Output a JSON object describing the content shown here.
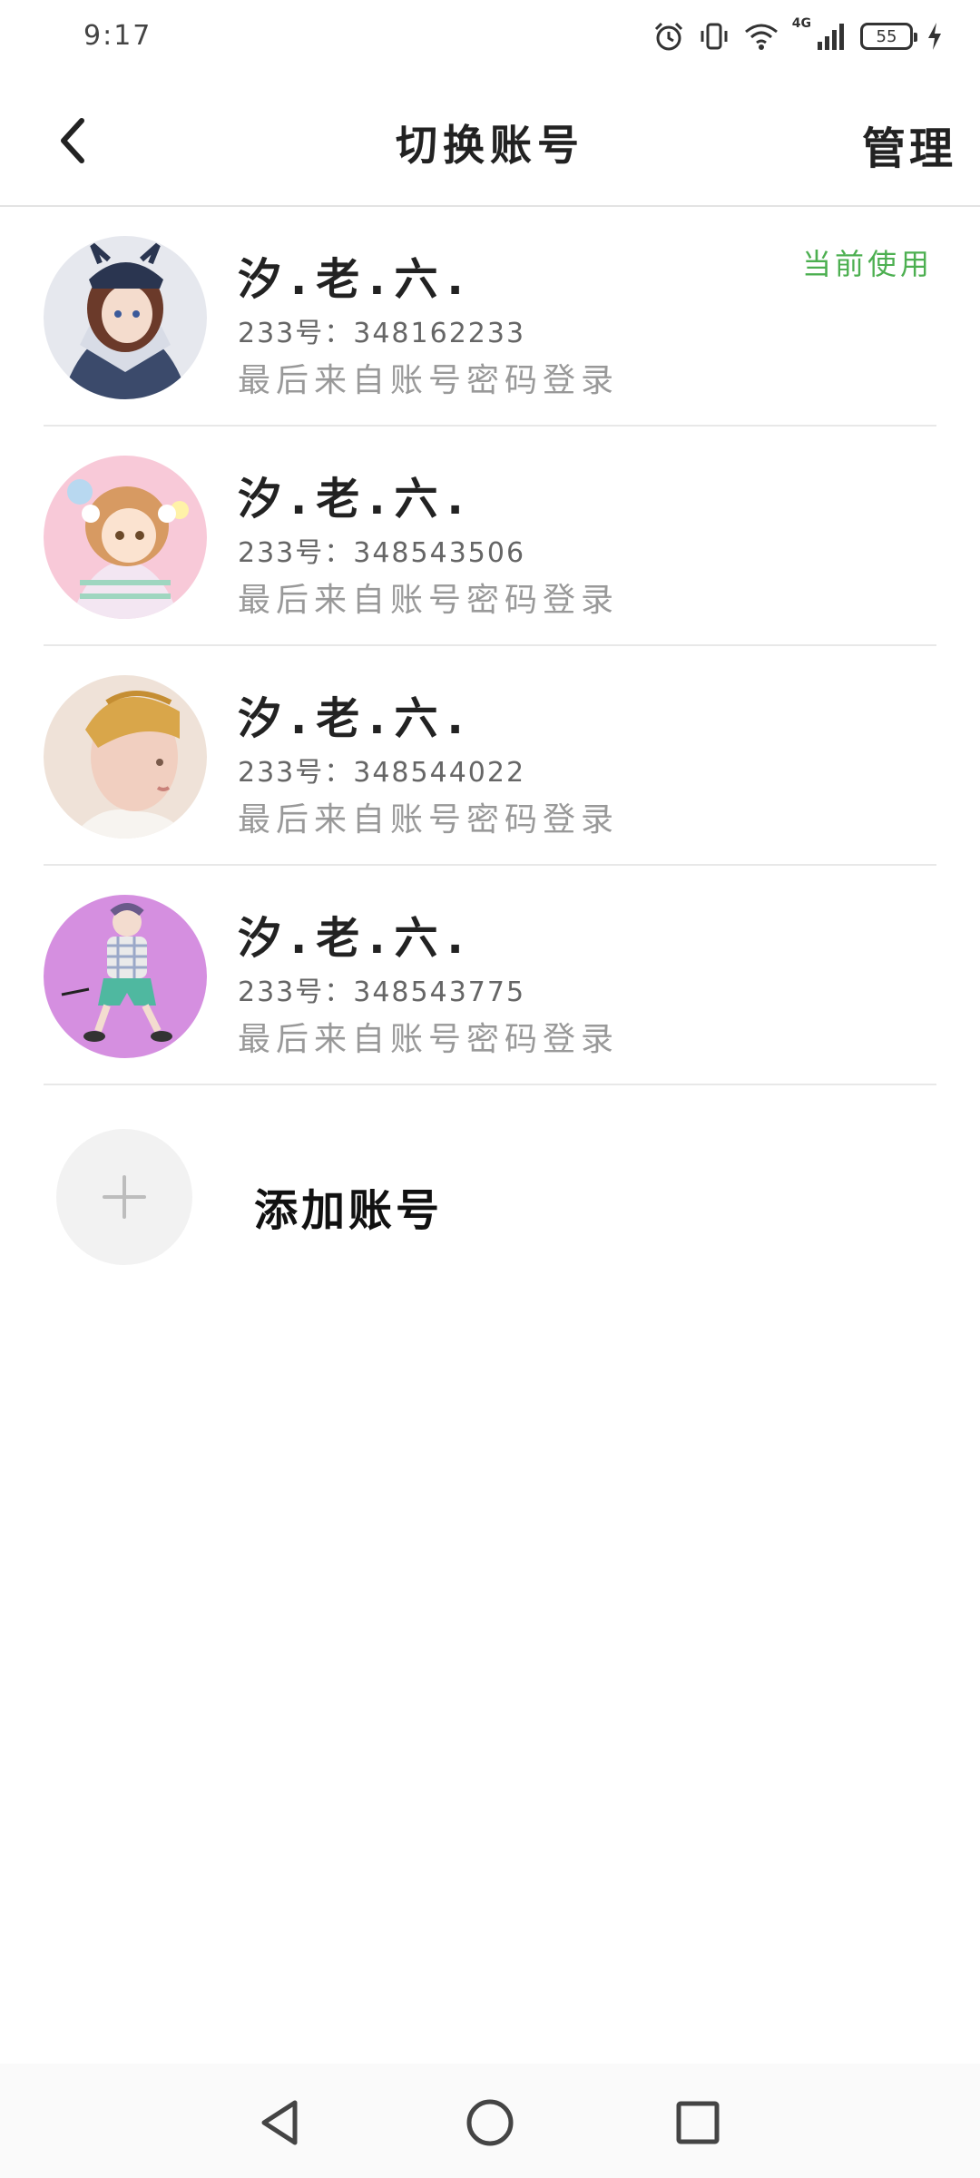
{
  "status_bar": {
    "time": "9:17",
    "network": "4G",
    "battery": "55",
    "icons": [
      "alarm-icon",
      "vibrate-icon",
      "wifi-icon",
      "signal-icon",
      "battery-icon",
      "charging-icon"
    ]
  },
  "header": {
    "title": "切换账号",
    "manage_label": "管理"
  },
  "accounts": [
    {
      "name": "汐.老.六.",
      "id_line": "233号：348162233",
      "login_line": "最后来自账号密码登录",
      "badge": "当前使用"
    },
    {
      "name": "汐.老.六.",
      "id_line": "233号：348543506",
      "login_line": "最后来自账号密码登录"
    },
    {
      "name": "汐.老.六.",
      "id_line": "233号：348544022",
      "login_line": "最后来自账号密码登录"
    },
    {
      "name": "汐.老.六.",
      "id_line": "233号：348543775",
      "login_line": "最后来自账号密码登录"
    }
  ],
  "add_account": {
    "label": "添加账号"
  },
  "colors": {
    "accent_green": "#4caf50",
    "divider": "#e8e8e8"
  }
}
